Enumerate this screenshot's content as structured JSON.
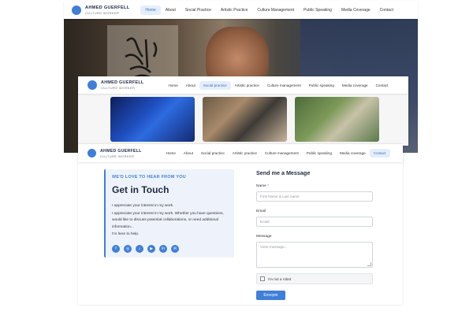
{
  "brand": {
    "name": "AHMED GUERFELL",
    "subtitle": "CULTURE WORKER"
  },
  "nav_top": [
    "Home",
    "About",
    "Social Practice",
    "Artistic Practice",
    "Culture Management",
    "Public Speaking",
    "Media Coverage",
    "Contact"
  ],
  "nav_top_active": "Home",
  "nav_lower": [
    "Home",
    "About",
    "Social practice",
    "Artistic practice",
    "Culture management",
    "Public speaking",
    "Media coverage",
    "Contact"
  ],
  "nav_practice_active": "Social practice",
  "nav_contact_active": "Contact",
  "contact": {
    "eyebrow": "WE'D LOVE TO HEAR FROM YOU",
    "title": "Get in Touch",
    "p1": "I appreciate your interest in my work.",
    "p2": "I appreciate your interest in my work. Whether you have questions, would like to discuss potential collaborations, or need additional information...",
    "p3": "I'm here to help.",
    "social_icons": [
      "facebook-icon",
      "instagram-icon",
      "tiktok-icon",
      "youtube-icon",
      "linkedin-icon",
      "email-icon"
    ]
  },
  "form": {
    "title": "Send me a Message",
    "name_label": "Name",
    "name_required": "*",
    "name_placeholder": "First Name & Last name",
    "email_label": "Email",
    "email_placeholder": "Email",
    "message_label": "Message",
    "message_placeholder": "Votre message...",
    "captcha_label": "I'm not a robot",
    "submit_label": "Envoyer"
  },
  "colors": {
    "accent": "#3f7fd8",
    "active_bg": "#e4eefb"
  }
}
